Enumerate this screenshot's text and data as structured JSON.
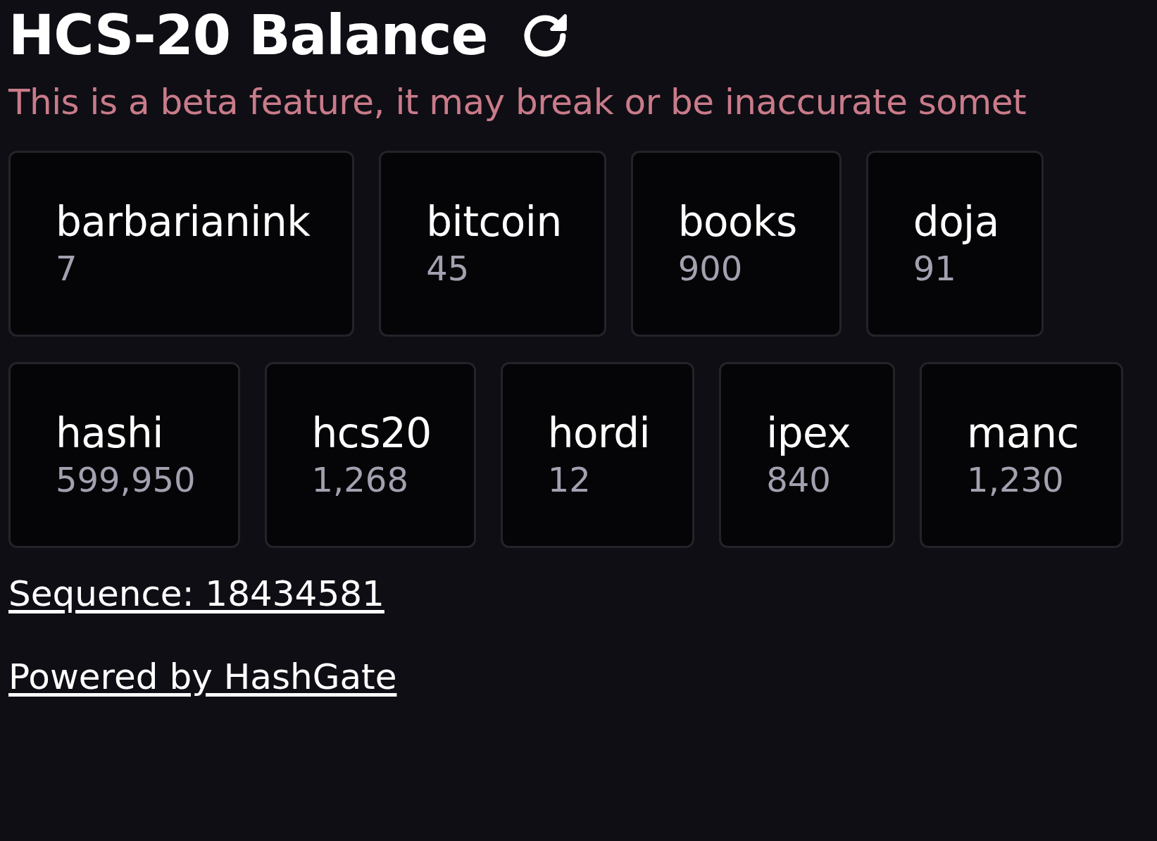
{
  "header": {
    "title": "HCS-20 Balance"
  },
  "warning": "This is a beta feature, it may break or be inaccurate somet",
  "token_rows": [
    [
      {
        "name": "barbarianink",
        "amount": "7"
      },
      {
        "name": "bitcoin",
        "amount": "45"
      },
      {
        "name": "books",
        "amount": "900"
      },
      {
        "name": "doja",
        "amount": "91"
      }
    ],
    [
      {
        "name": "hashi",
        "amount": "599,950"
      },
      {
        "name": "hcs20",
        "amount": "1,268"
      },
      {
        "name": "hordi",
        "amount": "12"
      },
      {
        "name": "ipex",
        "amount": "840"
      },
      {
        "name": "manc",
        "amount": "1,230"
      }
    ]
  ],
  "links": [
    "Sequence: 18434581",
    "Powered by HashGate"
  ]
}
